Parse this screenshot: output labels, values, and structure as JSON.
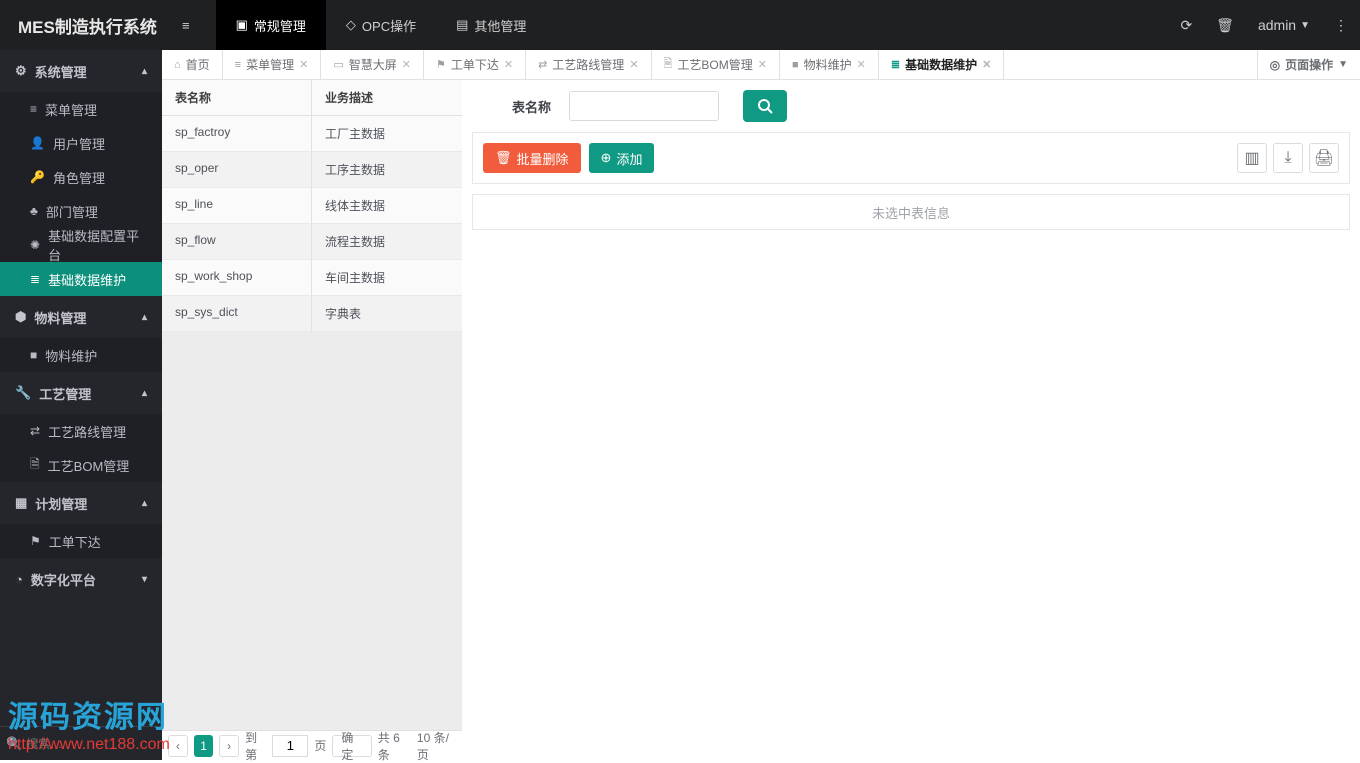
{
  "app_title": "MES制造执行系统",
  "top_menu": {
    "toggle": "☰",
    "items": [
      {
        "icon": "page-icon",
        "label": "常规管理"
      },
      {
        "icon": "opc-icon",
        "label": "OPC操作"
      },
      {
        "icon": "other-icon",
        "label": "其他管理"
      }
    ]
  },
  "top_actions": {
    "refresh": "⟳",
    "delete": "🗑",
    "user": "admin",
    "more": "⋮"
  },
  "sidebar": {
    "groups": [
      {
        "icon": "gears-icon",
        "label": "系统管理",
        "expanded": true,
        "children": [
          {
            "icon": "list-icon",
            "label": "菜单管理"
          },
          {
            "icon": "user-icon",
            "label": "用户管理"
          },
          {
            "icon": "lock-icon",
            "label": "角色管理"
          },
          {
            "icon": "dept-icon",
            "label": "部门管理"
          },
          {
            "icon": "gear-icon",
            "label": "基础数据配置平台"
          },
          {
            "icon": "db-icon",
            "label": "基础数据维护",
            "active": true
          }
        ]
      },
      {
        "icon": "cubes-icon",
        "label": "物料管理",
        "expanded": true,
        "children": [
          {
            "icon": "cube-icon",
            "label": "物料维护"
          }
        ]
      },
      {
        "icon": "wrench-icon",
        "label": "工艺管理",
        "expanded": true,
        "children": [
          {
            "icon": "route-icon",
            "label": "工艺路线管理"
          },
          {
            "icon": "doc-icon",
            "label": "工艺BOM管理"
          }
        ]
      },
      {
        "icon": "calendar-icon",
        "label": "计划管理",
        "expanded": true,
        "children": [
          {
            "icon": "flag-icon",
            "label": "工单下达"
          }
        ]
      },
      {
        "icon": "chart-icon",
        "label": "数字化平台",
        "expanded": false
      }
    ],
    "search_placeholder": "搜索…"
  },
  "tabs": [
    {
      "icon": "home-icon",
      "label": "首页",
      "closable": false
    },
    {
      "icon": "list-icon",
      "label": "菜单管理",
      "closable": true
    },
    {
      "icon": "screen-icon",
      "label": "智慧大屏",
      "closable": true
    },
    {
      "icon": "flag-icon",
      "label": "工单下达",
      "closable": true
    },
    {
      "icon": "route-icon",
      "label": "工艺路线管理",
      "closable": true
    },
    {
      "icon": "doc-icon",
      "label": "工艺BOM管理",
      "closable": true
    },
    {
      "icon": "cube-icon",
      "label": "物料维护",
      "closable": true
    },
    {
      "icon": "db-icon",
      "label": "基础数据维护",
      "closable": true,
      "active": true
    }
  ],
  "page_ops": {
    "icon": "target-icon",
    "label": "页面操作"
  },
  "left_table": {
    "headers": [
      "表名称",
      "业务描述"
    ],
    "rows": [
      {
        "name": "sp_factroy",
        "desc": "工厂主数据"
      },
      {
        "name": "sp_oper",
        "desc": "工序主数据"
      },
      {
        "name": "sp_line",
        "desc": "线体主数据"
      },
      {
        "name": "sp_flow",
        "desc": "流程主数据"
      },
      {
        "name": "sp_work_shop",
        "desc": "车间主数据"
      },
      {
        "name": "sp_sys_dict",
        "desc": "字典表"
      }
    ]
  },
  "pager": {
    "current": "1",
    "goto_text": "到第",
    "goto_value": "1",
    "page_text": "页",
    "confirm": "确定",
    "total": "共 6 条",
    "size": "10 条/页"
  },
  "search": {
    "label": "表名称",
    "value": ""
  },
  "toolbar": {
    "delete": "批量删除",
    "add": "添加"
  },
  "empty_msg": "未选中表信息",
  "watermark": {
    "line1": "源码资源网",
    "line2": "http://www.net188.com"
  }
}
